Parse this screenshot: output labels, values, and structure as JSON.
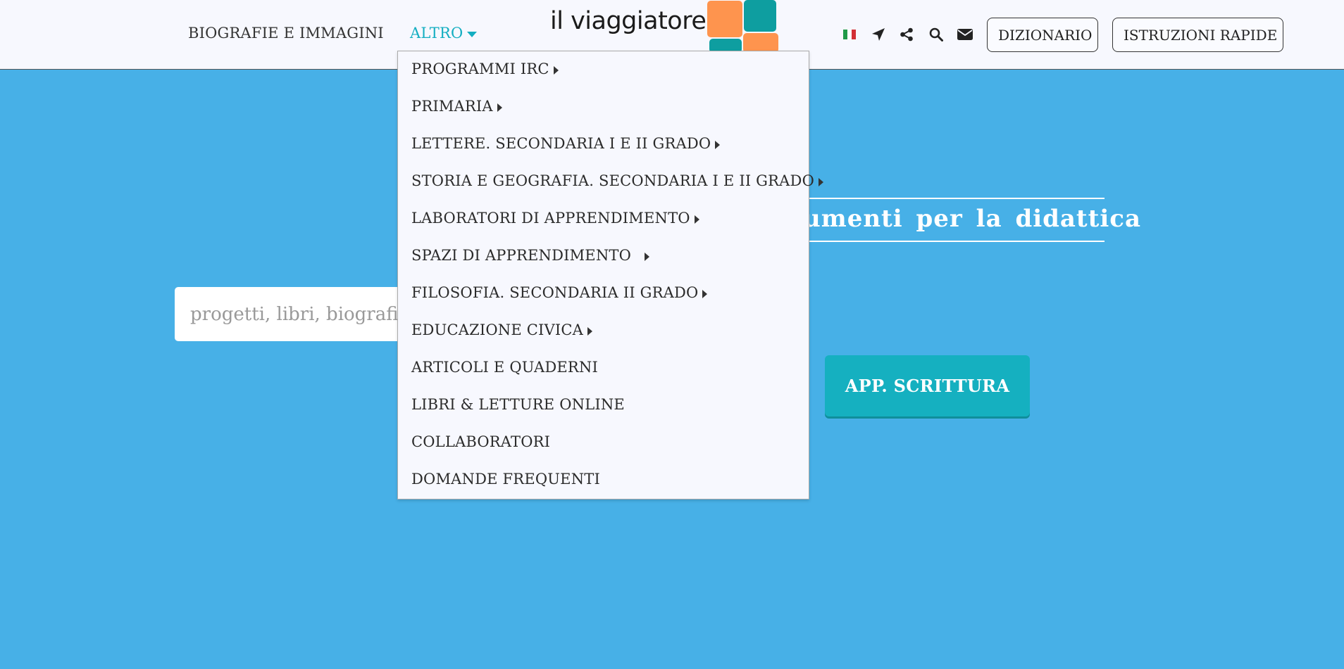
{
  "header": {
    "nav_bio": "BIOGRAFIE E IMMAGINI",
    "nav_altro": "ALTRO",
    "logo_text": "il viaggiatore",
    "btn_dizionario": "DIZIONARIO",
    "btn_istruzioni": "ISTRUZIONI RAPIDE",
    "icons": [
      "italian-flag-icon",
      "location-arrow-icon",
      "share-icon",
      "search-icon",
      "envelope-icon"
    ]
  },
  "hero": {
    "title": "umenti per la didattica",
    "search_placeholder": "progetti, libri, biografie,",
    "app_button": "APP. SCRITTURA"
  },
  "dropdown": {
    "items": [
      {
        "label": "PROGRAMMI IRC",
        "submenu": true
      },
      {
        "label": "PRIMARIA",
        "submenu": true
      },
      {
        "label": "LETTERE. SECONDARIA I E II GRADO",
        "submenu": true
      },
      {
        "label": "STORIA E GEOGRAFIA. SECONDARIA I E II GRADO",
        "submenu": true
      },
      {
        "label": "LABORATORI DI APPRENDIMENTO",
        "submenu": true
      },
      {
        "label": "SPAZI DI APPRENDIMENTO ",
        "submenu": true
      },
      {
        "label": "FILOSOFIA. SECONDARIA II GRADO",
        "submenu": true
      },
      {
        "label": "EDUCAZIONE CIVICA",
        "submenu": true
      },
      {
        "label": "ARTICOLI E QUADERNI",
        "submenu": false
      },
      {
        "label": "LIBRI & LETTURE ONLINE",
        "submenu": false
      },
      {
        "label": "COLLABORATORI",
        "submenu": false
      },
      {
        "label": "DOMANDE FREQUENTI",
        "submenu": false
      }
    ]
  },
  "colors": {
    "background": "#47b0e7",
    "header": "#f7f8fe",
    "accent": "#14aec1",
    "logo_orange": "#fe944e",
    "logo_teal": "#0e9ea0"
  }
}
